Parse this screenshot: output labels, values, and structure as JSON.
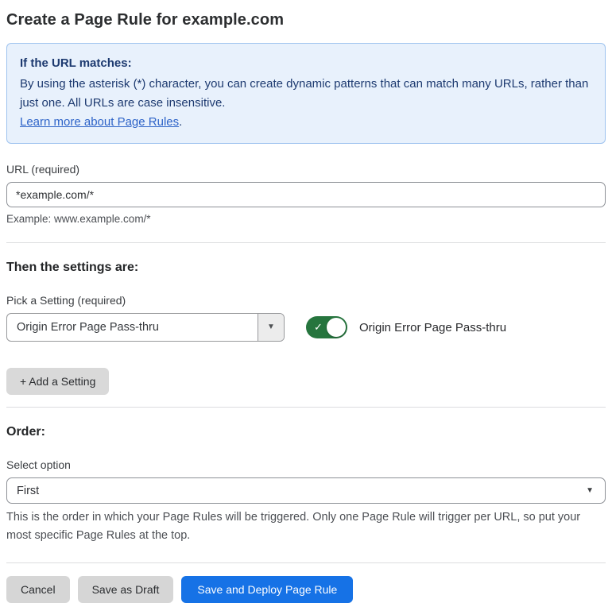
{
  "page": {
    "title": "Create a Page Rule for example.com"
  },
  "info_box": {
    "heading": "If the URL matches:",
    "body": "By using the asterisk (*) character, you can create dynamic patterns that can match many URLs, rather than just one. All URLs are case insensitive.",
    "link_text": "Learn more about Page Rules",
    "link_suffix": "."
  },
  "url_field": {
    "label": "URL (required)",
    "value": "*example.com/*",
    "helper": "Example: www.example.com/*"
  },
  "settings_section": {
    "heading": "Then the settings are:",
    "picker_label": "Pick a Setting (required)",
    "picker_value": "Origin Error Page Pass-thru",
    "toggle_state": "on",
    "toggle_check_glyph": "✓",
    "toggle_label": "Origin Error Page Pass-thru",
    "add_button_label": "+ Add a Setting"
  },
  "order_section": {
    "heading": "Order:",
    "select_label": "Select option",
    "select_value": "First",
    "helper": "This is the order in which your Page Rules will be triggered. Only one Page Rule will trigger per URL, so put your most specific Page Rules at the top."
  },
  "footer": {
    "cancel_label": "Cancel",
    "save_draft_label": "Save as Draft",
    "save_deploy_label": "Save and Deploy Page Rule"
  },
  "icons": {
    "dropdown_arrow": "▼"
  },
  "colors": {
    "info_bg": "#e8f1fc",
    "info_border": "#9ec3ef",
    "info_text": "#1d3a70",
    "link_color": "#2d63c8",
    "toggle_on": "#26753e",
    "primary_btn": "#1672e6"
  }
}
